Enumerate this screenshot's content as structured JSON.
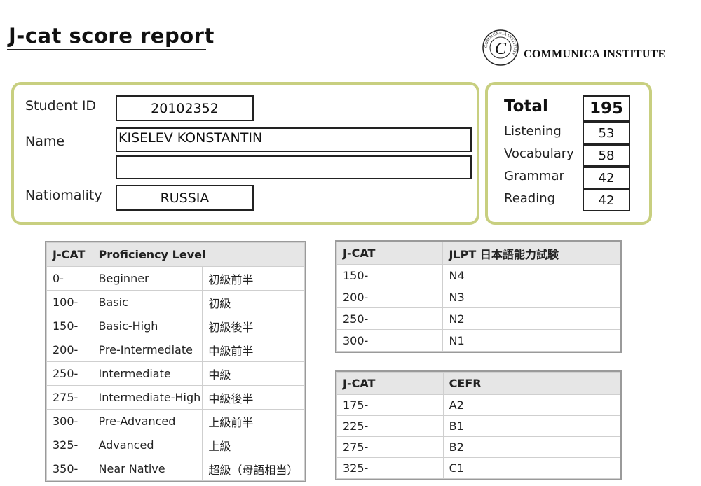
{
  "header": {
    "title": "J-cat score report",
    "institute": "COMMUNICA INSTITUTE",
    "logo_letter": "C",
    "logo_ring_text": "COMMUNICA INSTITUTE"
  },
  "student": {
    "id_label": "Student ID",
    "id_value": "20102352",
    "name_label": "Name",
    "name_value": "KISELEV KONSTANTIN",
    "name_value_2": "",
    "nationality_label": "Natiomality",
    "nationality_value": "RUSSIA"
  },
  "scores": {
    "total_label": "Total",
    "total_value": "195",
    "items": [
      {
        "label": "Listening",
        "value": "53"
      },
      {
        "label": "Vocabulary",
        "value": "58"
      },
      {
        "label": "Grammar",
        "value": "42"
      },
      {
        "label": "Reading",
        "value": "42"
      }
    ]
  },
  "proficiency_table": {
    "headers": [
      "J-CAT",
      "Proficiency Level"
    ],
    "rows": [
      [
        "0-",
        "Beginner",
        "初級前半"
      ],
      [
        "100-",
        "Basic",
        "初級"
      ],
      [
        "150-",
        "Basic-High",
        "初級後半"
      ],
      [
        "200-",
        "Pre-Intermediate",
        "中級前半"
      ],
      [
        "250-",
        "Intermediate",
        "中級"
      ],
      [
        "275-",
        "Intermediate-High",
        "中級後半"
      ],
      [
        "300-",
        "Pre-Advanced",
        "上級前半"
      ],
      [
        "325-",
        "Advanced",
        "上級"
      ],
      [
        "350-",
        "Near Native",
        "超級（母語相当）"
      ]
    ]
  },
  "jlpt_table": {
    "headers": [
      "J-CAT",
      "JLPT 日本語能力試験"
    ],
    "rows": [
      [
        "150-",
        "N4"
      ],
      [
        "200-",
        "N3"
      ],
      [
        "250-",
        "N2"
      ],
      [
        "300-",
        "N1"
      ]
    ]
  },
  "cefr_table": {
    "headers": [
      "J-CAT",
      "CEFR"
    ],
    "rows": [
      [
        "175-",
        "A2"
      ],
      [
        "225-",
        "B1"
      ],
      [
        "275-",
        "B2"
      ],
      [
        "325-",
        "C1"
      ]
    ]
  },
  "colors": {
    "panel_border": "#c8cf80",
    "table_header_bg": "#e6e6e6"
  }
}
